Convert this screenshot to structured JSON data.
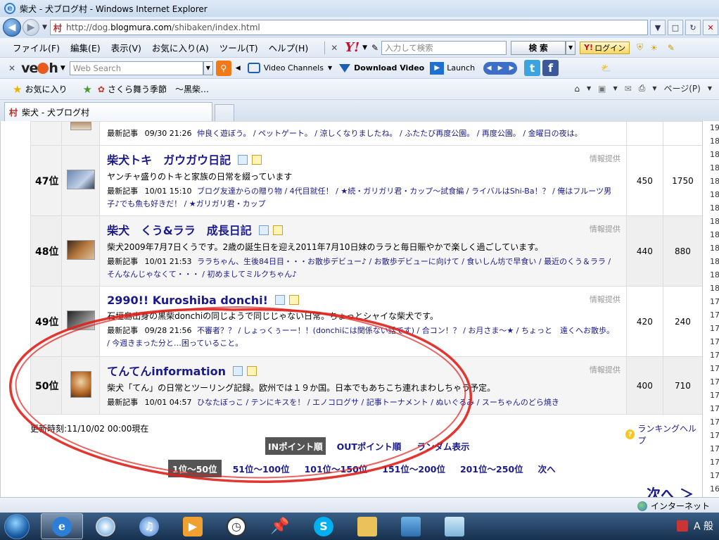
{
  "window": {
    "title": "柴犬 - 犬ブログ村 - Windows Internet Explorer"
  },
  "address": {
    "url_prefix": "http://dog.",
    "url_host": "blogmura.com",
    "url_path": "/shibaken/index.html"
  },
  "menu": {
    "items": [
      "ファイル(F)",
      "編集(E)",
      "表示(V)",
      "お気に入り(A)",
      "ツール(T)",
      "ヘルプ(H)"
    ],
    "search_placeholder": "入力して検索",
    "search_button": "検 索",
    "login_label": "ログイン"
  },
  "veoh": {
    "search_placeholder": "Web Search",
    "channels_label": "Video Channels",
    "download_label": "Download Video",
    "launch_label": "Launch"
  },
  "favorites": {
    "favorites_label": "お気に入り",
    "item_label": "さくら舞う季節　～黒柴…",
    "page_label": "ページ(P)"
  },
  "tab": {
    "title": "柴犬 - 犬ブログ村"
  },
  "rows": [
    {
      "rank": "",
      "title": "",
      "desc": "",
      "recent_label": "最新記事",
      "date": "09/30 21:26",
      "posts": "仲良く遊ぼう。 / ペットゲート。 / 涼しくなりましたね。 / ふたたび再度公園。 / 再度公園。 / 金曜日の夜は。",
      "in": "",
      "out": ""
    },
    {
      "rank": "47位",
      "title": "柴犬トキ　ガウガウ日記",
      "desc": "ヤンチャ盛りのトキと家族の日常を綴っています",
      "recent_label": "最新記事",
      "date": "10/01 15:10",
      "posts": "ブログ友達からの贈り物 / 4代目就任！ / ★続・ガリガリ君・カップ～試食編 / ライバルはShi-Ba！？ / 俺はフルーツ男子♪でも魚も好きだ！ / ★ガリガリ君・カップ",
      "info": "情報提供",
      "in": "450",
      "out": "1750"
    },
    {
      "rank": "48位",
      "title": "柴犬　くう&ララ　成長日記",
      "desc": "柴犬2009年7月7日くうです。2歳の誕生日を迎え2011年7月10日妹のララと毎日賑やかで楽しく過ごしています。",
      "recent_label": "最新記事",
      "date": "10/01 21:53",
      "posts": "ララちゃん、生後84日目・・・お散歩デビュー♪ / お散歩デビューに向けて / 食いしん坊で早食い / 最近のくう＆ララ / そんなんじゃなくて・・・ / 初めましてミルクちゃん♪",
      "info": "情報提供",
      "in": "440",
      "out": "880"
    },
    {
      "rank": "49位",
      "title": "2990!! Kuroshiba donchi!",
      "desc": "石垣島出身の黒柴donchiの同じようで同じじゃない日常。ちょっとシャイな柴犬です。",
      "recent_label": "最新記事",
      "date": "09/28 21:56",
      "posts": "不審者？？ / しょっくぅーー！！(donchiには関係ない話です) / 合コン！？ / お月さま～★ / ちょっと　遠くへお散歩。 / 今週きまった分と…困っていること。",
      "info": "情報提供",
      "in": "420",
      "out": "240"
    },
    {
      "rank": "50位",
      "title": "てんてんinformation",
      "desc": "柴犬「てん」の日常とツーリング記録。欧州では１９か国。日本でもあちこち連れまわしちゃう予定。",
      "recent_label": "最新記事",
      "date": "10/01 04:57",
      "posts": "ひなたぼっこ / テンにキスを！ / エノコログサ / 記事トーナメント / ぬいぐるみ / スーちゃんのどら焼き",
      "info": "情報提供",
      "in": "400",
      "out": "710"
    }
  ],
  "footer": {
    "update_time": "更新時刻:11/10/02 00:00現在",
    "help": "ランキングヘルプ",
    "sort_active": "INポイント順",
    "sort_out": "OUTポイント順",
    "sort_random": "ランダム表示",
    "pages": [
      "1位～50位",
      "51位～100位",
      "101位～150位",
      "151位～200位",
      "201位～250位",
      "次へ"
    ],
    "next_big": "次へ ＞"
  },
  "right_strip": [
    "19",
    "18",
    "18",
    "18",
    "18",
    "18",
    "18",
    "18",
    "18",
    "18",
    "18",
    "18",
    "18",
    "17",
    "17",
    "17",
    "17",
    "17",
    "17",
    "17",
    "17",
    "17",
    "17",
    "17",
    "17",
    "17",
    "17",
    "16"
  ],
  "status": {
    "zone": "インターネット"
  },
  "tray": {
    "ime": "A 般"
  }
}
